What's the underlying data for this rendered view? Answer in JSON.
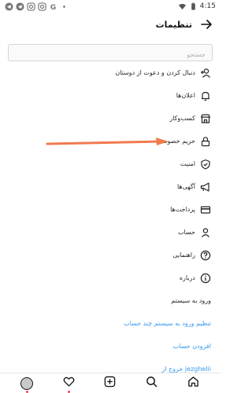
{
  "status": {
    "time": "4:15",
    "icons": [
      "telegram-icon",
      "telegram-icon",
      "instagram-icon",
      "instagram-icon",
      "google-icon",
      "dot-icon"
    ]
  },
  "header": {
    "title": "تنظیمات",
    "back_icon": "arrow-right-icon"
  },
  "search": {
    "placeholder": "جستجو",
    "value": ""
  },
  "menu": [
    {
      "label": "دنبال کردن و دعوت از دوستان",
      "icon": "add-person-icon"
    },
    {
      "label": "اعلان‌ها",
      "icon": "bell-icon"
    },
    {
      "label": "کسب‌وکار",
      "icon": "shop-icon"
    },
    {
      "label": "حریم خصوصی",
      "icon": "lock-icon"
    },
    {
      "label": "امنیت",
      "icon": "shield-icon"
    },
    {
      "label": "آگهی‌ها",
      "icon": "megaphone-icon"
    },
    {
      "label": "پرداخت‌ها",
      "icon": "card-icon"
    },
    {
      "label": "حساب",
      "icon": "person-icon"
    },
    {
      "label": "راهنمایی",
      "icon": "help-icon"
    },
    {
      "label": "درباره",
      "icon": "info-icon"
    }
  ],
  "login_section": {
    "title": "ورود به سیستم",
    "multi_account": "تنظیم ورود به سیستم چند حساب",
    "add_account": "افزودن حساب",
    "logout": "خروج از jezghelii"
  },
  "colors": {
    "link": "#3897f0",
    "annotation_arrow": "#f07a4f",
    "notification_dot": "#ed4956"
  },
  "bottom_nav": [
    "avatar",
    "heart-icon",
    "plus-square-icon",
    "search-icon",
    "home-icon"
  ]
}
